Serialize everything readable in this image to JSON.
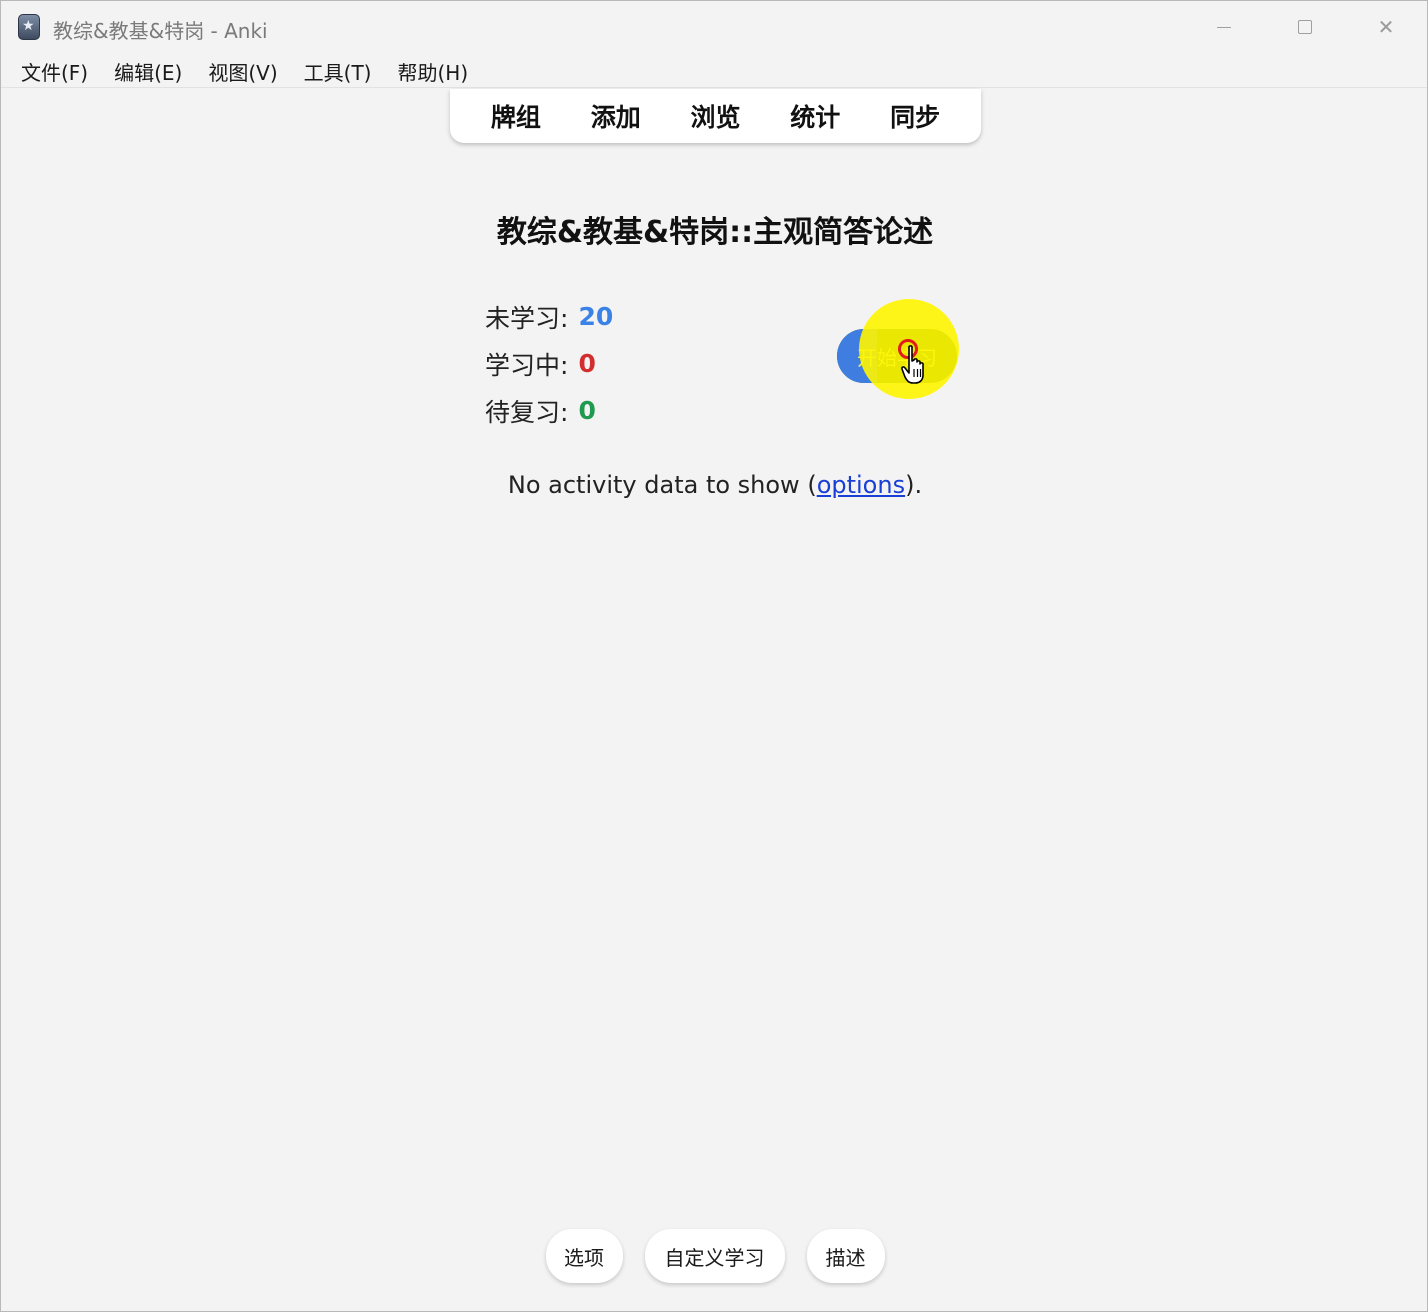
{
  "window": {
    "title": "教综&教基&特岗 - Anki"
  },
  "menu": {
    "items": [
      {
        "label": "文件(F)"
      },
      {
        "label": "编辑(E)"
      },
      {
        "label": "视图(V)"
      },
      {
        "label": "工具(T)"
      },
      {
        "label": "帮助(H)"
      }
    ]
  },
  "toolbar": {
    "items": [
      {
        "label": "牌组"
      },
      {
        "label": "添加"
      },
      {
        "label": "浏览"
      },
      {
        "label": "统计"
      },
      {
        "label": "同步"
      }
    ]
  },
  "deck": {
    "title": "教综&教基&特岗::主观简答论述",
    "counts": {
      "new_label": "未学习:",
      "new_value": "20",
      "learn_label": "学习中:",
      "learn_value": "0",
      "review_label": "待复习:",
      "review_value": "0"
    },
    "study_button": "开始学习"
  },
  "activity": {
    "prefix": "No activity data to show (",
    "link": "options",
    "suffix": ")."
  },
  "bottom": {
    "options": "选项",
    "custom_study": "自定义学习",
    "description": "描述"
  },
  "colors": {
    "new": "#3b82e6",
    "learn": "#d22e2e",
    "review": "#1f9a4e"
  }
}
